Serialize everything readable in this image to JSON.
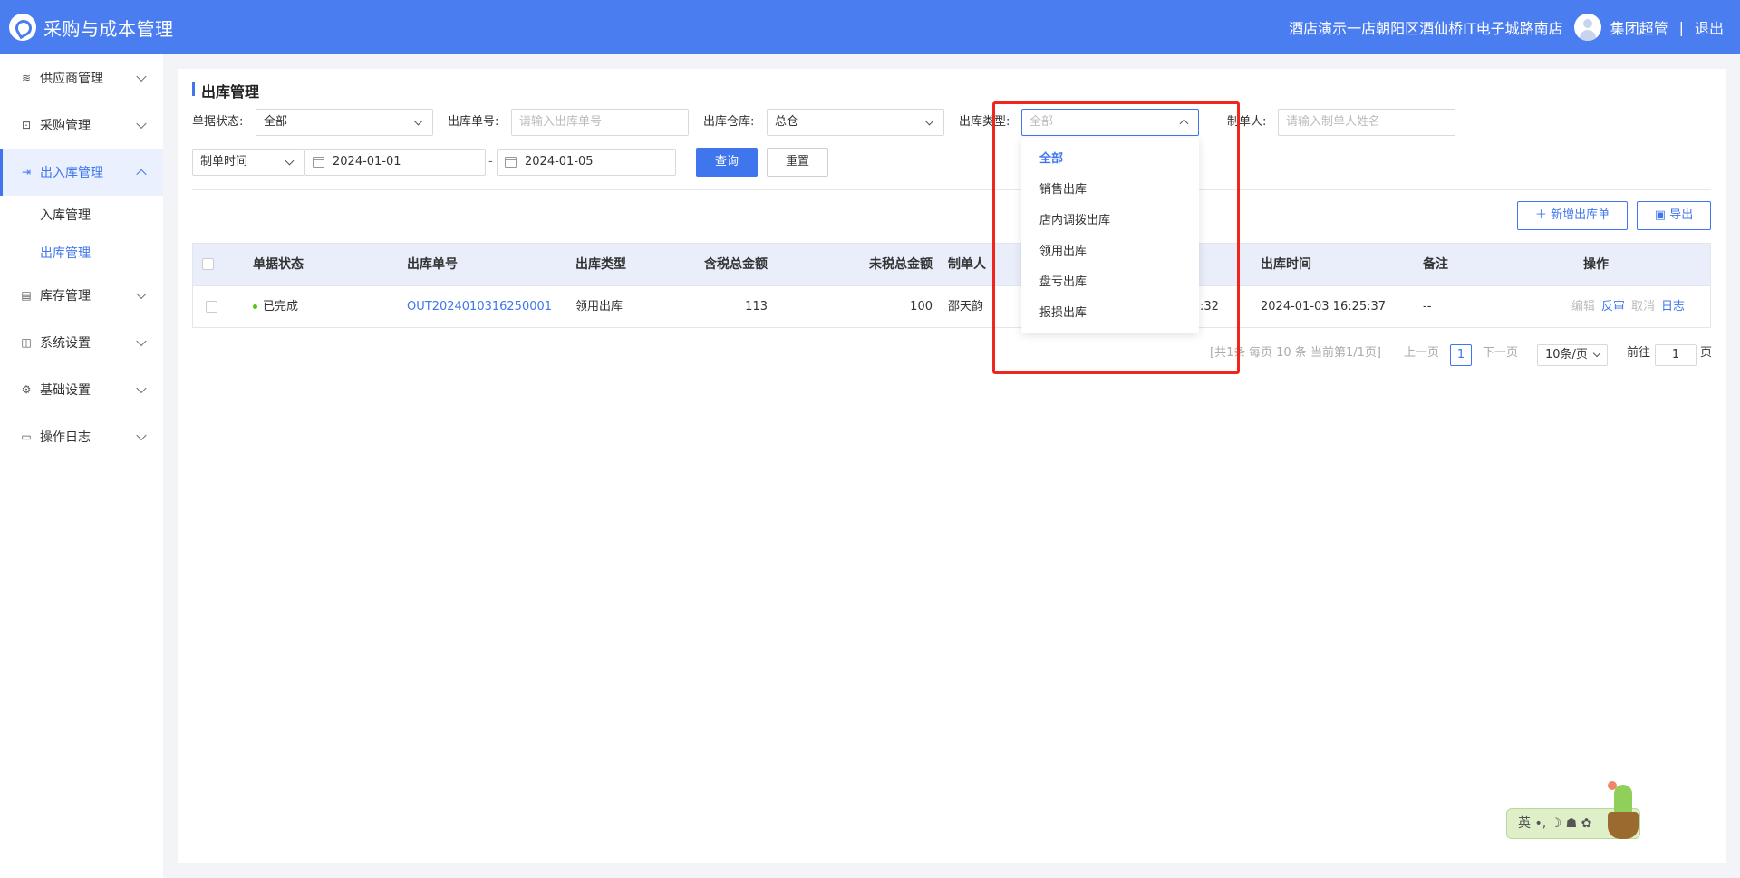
{
  "header": {
    "app_title": "采购与成本管理",
    "hotel_name": "酒店演示一店朝阳区酒仙桥IT电子城路南店",
    "user_name": "集团超管",
    "separator": "|",
    "logout": "退出"
  },
  "sidebar": {
    "items": [
      {
        "label": "供应商管理",
        "icon": "supplier-icon"
      },
      {
        "label": "采购管理",
        "icon": "purchase-icon"
      },
      {
        "label": "出入库管理",
        "icon": "warehouse-io-icon"
      },
      {
        "label": "库存管理",
        "icon": "inventory-icon"
      },
      {
        "label": "系统设置",
        "icon": "system-settings-icon"
      },
      {
        "label": "基础设置",
        "icon": "gear-icon"
      },
      {
        "label": "操作日志",
        "icon": "log-icon"
      }
    ],
    "sub_items": [
      {
        "label": "入库管理"
      },
      {
        "label": "出库管理"
      }
    ]
  },
  "page": {
    "title": "出库管理"
  },
  "filters": {
    "status_label": "单据状态:",
    "status_value": "全部",
    "order_no_label": "出库单号:",
    "order_no_placeholder": "请输入出库单号",
    "warehouse_label": "出库仓库:",
    "warehouse_value": "总仓",
    "type_label": "出库类型:",
    "type_placeholder": "全部",
    "creator_label": "制单人:",
    "creator_placeholder": "请输入制单人姓名",
    "time_type_value": "制单时间",
    "date_start": "2024-01-01",
    "date_separator": "-",
    "date_end": "2024-01-05",
    "query_button": "查询",
    "reset_button": "重置"
  },
  "actions": {
    "add_button": "新增出库单",
    "export_button": "导出"
  },
  "table": {
    "columns": [
      "单据状态",
      "出库单号",
      "出库类型",
      "含税总金额",
      "未税总金额",
      "制单人",
      "出库时间",
      "备注",
      "操作"
    ],
    "rows": [
      {
        "status": "已完成",
        "order_no": "OUT2024010316250001",
        "type": "领用出库",
        "amount_with_tax": "113",
        "amount_without_tax": "100",
        "creator": "邵天韵",
        "partial_time": ":32",
        "out_time": "2024-01-03 16:25:37",
        "remark": "--",
        "ops": {
          "edit": "编辑",
          "reverse": "反审",
          "cancel": "取消",
          "log": "日志"
        }
      }
    ]
  },
  "pagination": {
    "summary_left": "[共1条",
    "summary_right": "每页 10 条 当前第1/1页]",
    "prev": "上一页",
    "current_page": "1",
    "next": "下一页",
    "page_size": "10条/页",
    "goto_label": "前往",
    "goto_value": "1",
    "goto_suffix": "页"
  },
  "dropdown": {
    "options": [
      "全部",
      "销售出库",
      "店内调拨出库",
      "领用出库",
      "盘亏出库",
      "报损出库"
    ],
    "selected": "全部"
  },
  "ime_toolbar": {
    "text": "英 •, ☽ ☗ ✿"
  },
  "colors": {
    "primary": "#3f76ee",
    "header_bg": "#4a7df0",
    "highlight_border": "#f0261d",
    "status_done": "#52c41a"
  }
}
